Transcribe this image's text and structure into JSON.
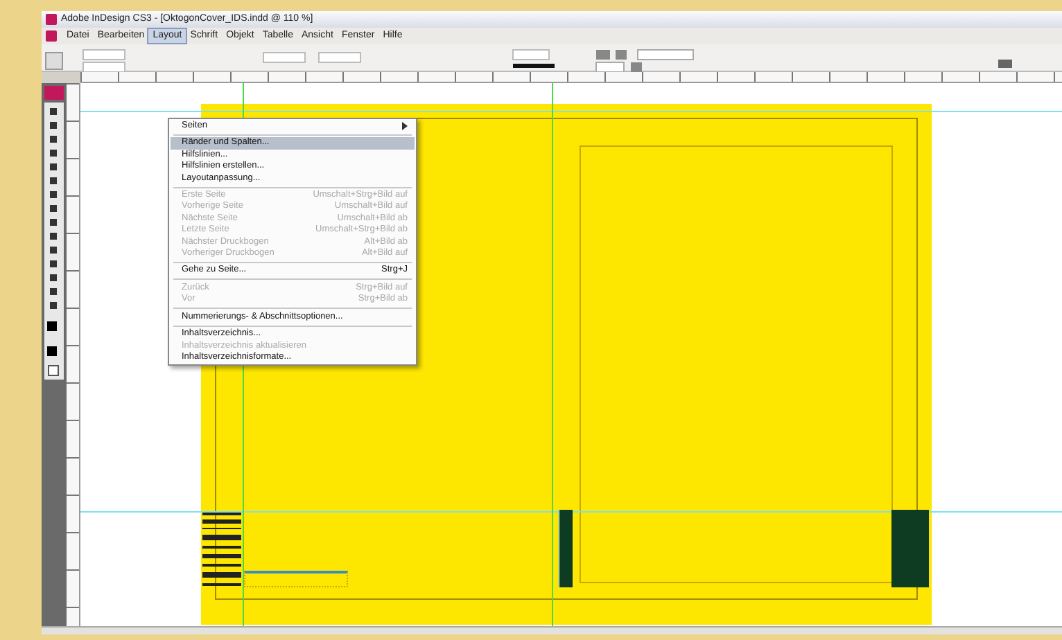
{
  "window": {
    "title": "Adobe InDesign CS3 - [OktogonCover_IDS.indd @ 110 %]"
  },
  "menu_bar": [
    {
      "label": "Datei",
      "selected": false
    },
    {
      "label": "Bearbeiten",
      "selected": false
    },
    {
      "label": "Layout",
      "selected": true
    },
    {
      "label": "Schrift",
      "selected": false
    },
    {
      "label": "Objekt",
      "selected": false
    },
    {
      "label": "Tabelle",
      "selected": false
    },
    {
      "label": "Ansicht",
      "selected": false
    },
    {
      "label": "Fenster",
      "selected": false
    },
    {
      "label": "Hilfe",
      "selected": false
    }
  ],
  "layout_menu": [
    {
      "kind": "submenu",
      "label": "Seiten",
      "selected": false,
      "disabled": false
    },
    {
      "kind": "separator"
    },
    {
      "kind": "item",
      "label": "Ränder und Spalten...",
      "selected": true,
      "disabled": false
    },
    {
      "kind": "item",
      "label": "Hilfslinien...",
      "selected": false,
      "disabled": false
    },
    {
      "kind": "item",
      "label": "Hilfslinien erstellen...",
      "selected": false,
      "disabled": false
    },
    {
      "kind": "item",
      "label": "Layoutanpassung...",
      "selected": false,
      "disabled": false
    },
    {
      "kind": "separator"
    },
    {
      "kind": "item",
      "label": "Erste Seite",
      "shortcut": "Umschalt+Strg+Bild auf",
      "selected": false,
      "disabled": true
    },
    {
      "kind": "item",
      "label": "Vorherige Seite",
      "shortcut": "Umschalt+Bild auf",
      "selected": false,
      "disabled": true
    },
    {
      "kind": "item",
      "label": "Nächste Seite",
      "shortcut": "Umschalt+Bild ab",
      "selected": false,
      "disabled": true
    },
    {
      "kind": "item",
      "label": "Letzte Seite",
      "shortcut": "Umschalt+Strg+Bild ab",
      "selected": false,
      "disabled": true
    },
    {
      "kind": "item",
      "label": "Nächster Druckbogen",
      "shortcut": "Alt+Bild ab",
      "selected": false,
      "disabled": true
    },
    {
      "kind": "item",
      "label": "Vorheriger Druckbogen",
      "shortcut": "Alt+Bild auf",
      "selected": false,
      "disabled": true
    },
    {
      "kind": "separator"
    },
    {
      "kind": "item",
      "label": "Gehe zu Seite...",
      "shortcut": "Strg+J",
      "selected": false,
      "disabled": false
    },
    {
      "kind": "separator"
    },
    {
      "kind": "item",
      "label": "Zurück",
      "shortcut": "Strg+Bild auf",
      "selected": false,
      "disabled": true
    },
    {
      "kind": "item",
      "label": "Vor",
      "shortcut": "Strg+Bild ab",
      "selected": false,
      "disabled": true
    },
    {
      "kind": "separator"
    },
    {
      "kind": "item",
      "label": "Nummerierungs- & Abschnittsoptionen...",
      "selected": false,
      "disabled": false
    },
    {
      "kind": "separator"
    },
    {
      "kind": "item",
      "label": "Inhaltsverzeichnis...",
      "selected": false,
      "disabled": false
    },
    {
      "kind": "item",
      "label": "Inhaltsverzeichnis aktualisieren",
      "selected": false,
      "disabled": true
    },
    {
      "kind": "item",
      "label": "Inhaltsverzeichnisformate...",
      "selected": false,
      "disabled": false
    }
  ]
}
